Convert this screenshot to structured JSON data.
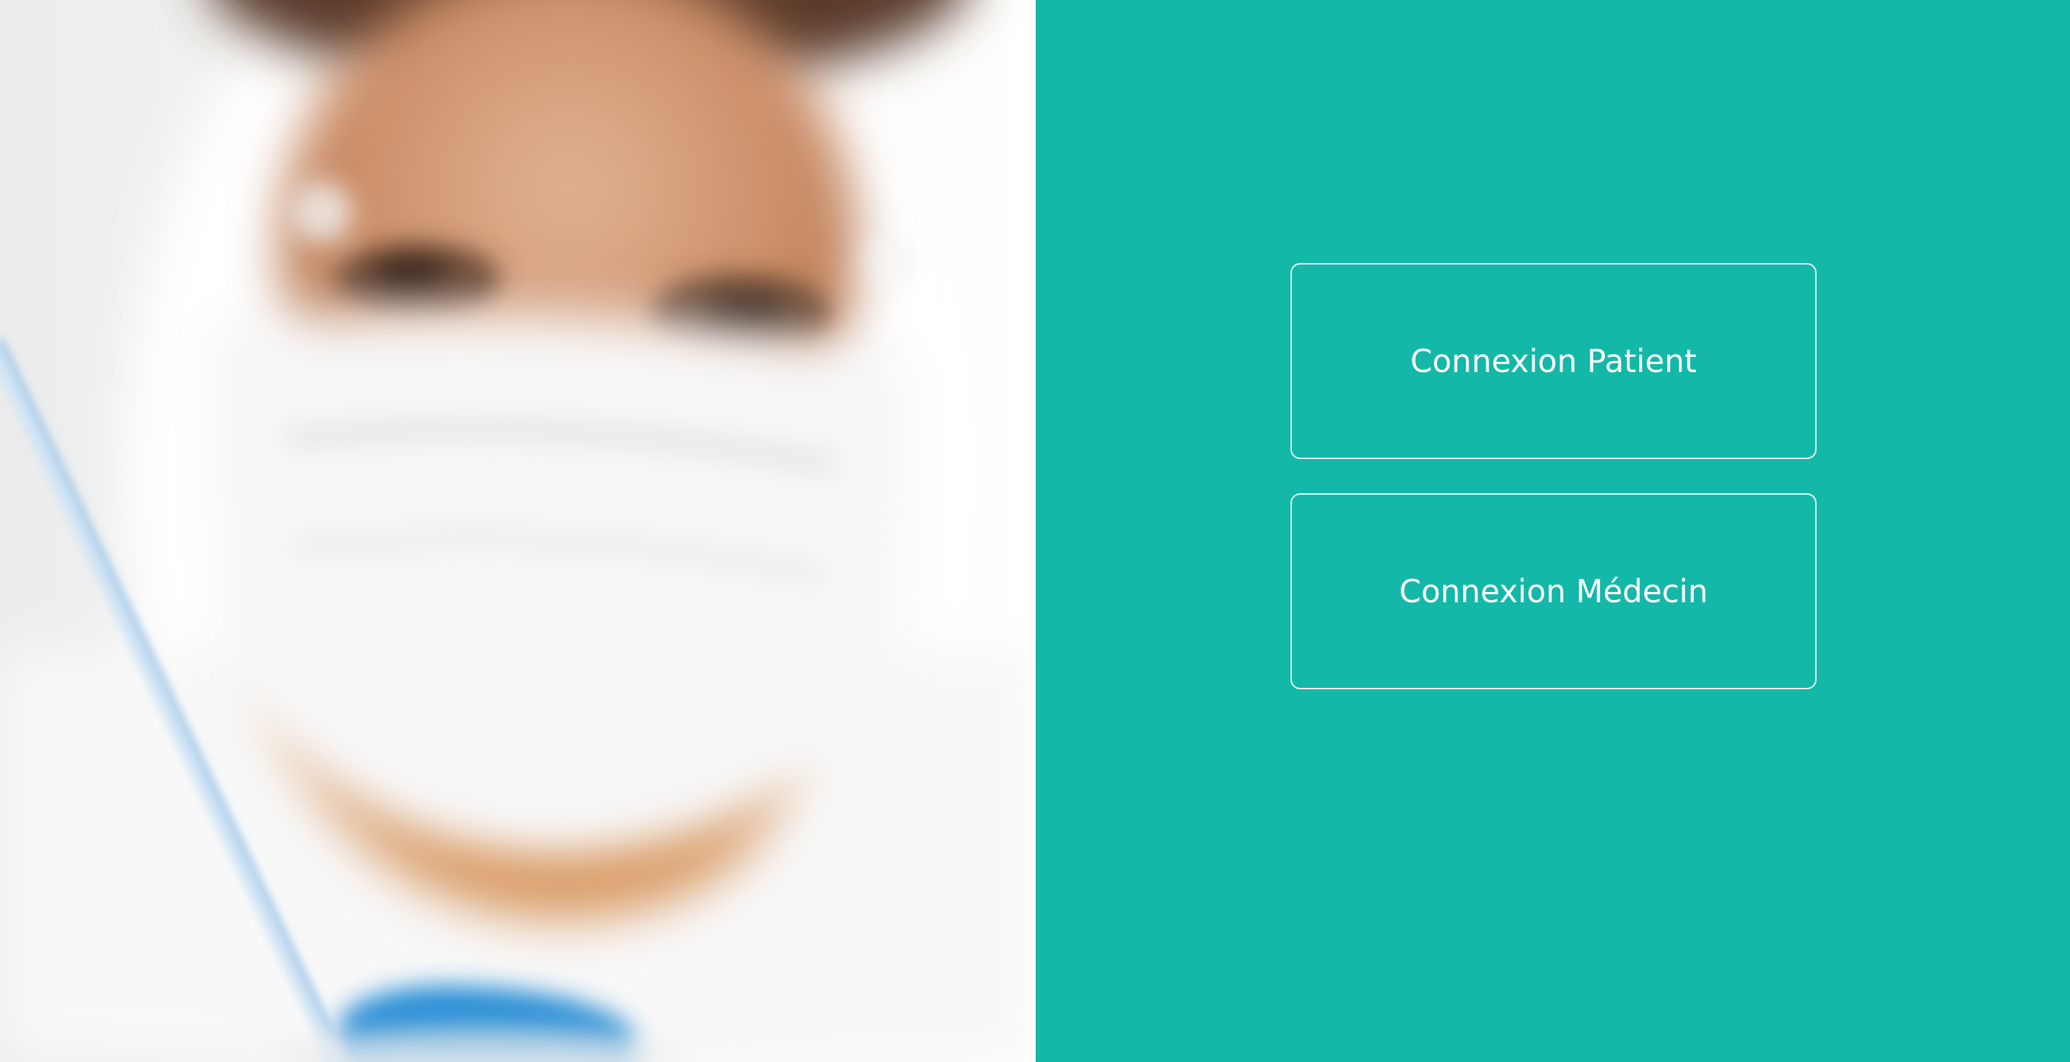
{
  "hero_image": {
    "description_icon": "blurred-lab-technician-photo",
    "colors": {
      "skin": "#d49a78",
      "mask": "#f4f4f4",
      "glove": "#2a8fd6",
      "background": "#f3f3f3"
    }
  },
  "login": {
    "background_color": "#13b8a8",
    "buttons": [
      {
        "label": "Connexion Patient"
      },
      {
        "label": "Connexion Médecin"
      }
    ]
  }
}
